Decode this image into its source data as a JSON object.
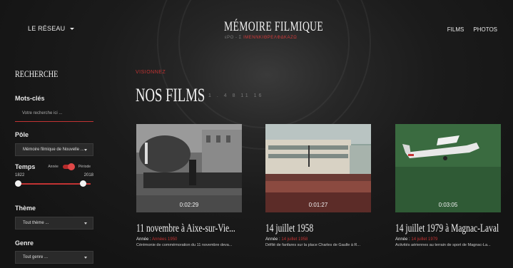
{
  "header": {
    "network_label": "LE RÉSEAU",
    "brand_title": "MÉMOIRE FILMIQUE",
    "brand_subtitle_grey": "εΡΟ - Σ ",
    "brand_subtitle_red": "ΙΜΕΝΝΚΙΘΡΕΛΦΔΚΑΖΩ",
    "nav": [
      "FILMS",
      "PHOTOS"
    ]
  },
  "sidebar": {
    "title": "RECHERCHE",
    "keywords_label": "Mots-clés",
    "search_placeholder": "Votre recherche ici ...",
    "pole_label": "Pôle",
    "pole_value": "Mémoire filmique de Nouvelle ...",
    "time_label": "Temps",
    "toggle_left": "Année",
    "toggle_right": "Période",
    "year_min": "1822",
    "year_max": "2018",
    "theme_label": "Thème",
    "theme_value": "Tout thème ...",
    "genre_label": "Genre",
    "genre_value": "Tout genre ..."
  },
  "main": {
    "eyebrow": "VISIONNEZ",
    "title": "NOS FILMS",
    "scale_numbers": "1 . 4   8   11   16"
  },
  "films": [
    {
      "duration": "0:02:29",
      "title": "11 novembre à Aixe-sur-Vie...",
      "year_label": "Année :",
      "year_value": "Années 1950",
      "description": "Cérémonie de commémoration du 11 novembre deva..."
    },
    {
      "duration": "0:01:27",
      "title": "14 juillet 1958",
      "year_label": "Année :",
      "year_value": "14 juillet 1958",
      "description": "Défilé de fanfares sur la place Charles de Gaulle à R..."
    },
    {
      "duration": "0:03:05",
      "title": "14 juillet 1979 à Magnac-Laval",
      "year_label": "Année :",
      "year_value": "14 juillet 1979",
      "description": "Activités aériennes au terrain de sport de Magnac-La..."
    }
  ],
  "colors": {
    "accent": "#c23333",
    "background": "#1a1a1a"
  }
}
